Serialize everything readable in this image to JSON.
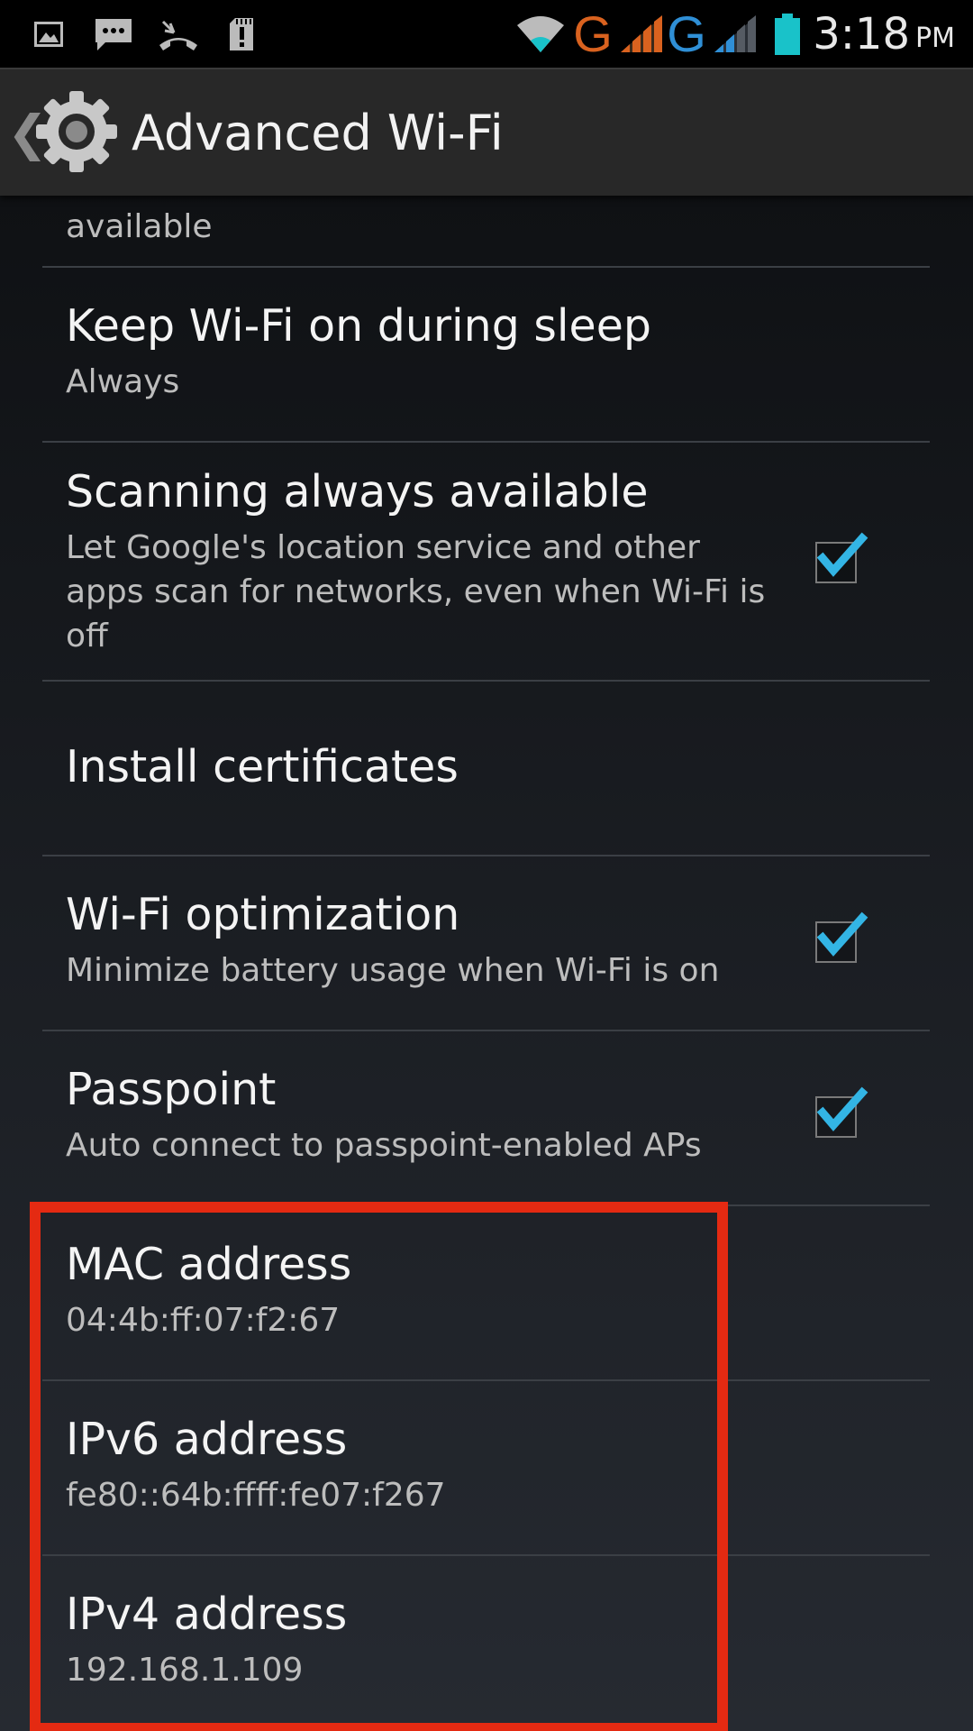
{
  "status_bar": {
    "time": "3:18",
    "ampm": "PM",
    "network_1": "G",
    "network_2": "G",
    "network_1_color": "#d9621f",
    "network_2_color": "#2f8fd6",
    "battery_color": "#19c2c9",
    "icons": [
      "gallery-icon",
      "message-icon",
      "missed-call-icon",
      "sd-card-alert-icon",
      "wifi-icon",
      "signal-icon",
      "battery-icon"
    ]
  },
  "action_bar": {
    "title": "Advanced Wi-Fi",
    "back_glyph": "❮",
    "icon": "settings-gear-icon"
  },
  "preferences": {
    "partial_summary": "available",
    "keep_wifi_on": {
      "title": "Keep Wi-Fi on during sleep",
      "summary": "Always"
    },
    "scanning": {
      "title": "Scanning always available",
      "summary": "Let Google's location service and other apps scan for networks, even when Wi-Fi is off",
      "checked": true
    },
    "install_certificates": {
      "title": "Install certificates"
    },
    "wifi_optimization": {
      "title": "Wi-Fi optimization",
      "summary": "Minimize battery usage when Wi-Fi is on",
      "checked": true
    },
    "passpoint": {
      "title": "Passpoint",
      "summary": "Auto connect to passpoint-enabled APs",
      "checked": true
    },
    "mac_address": {
      "title": "MAC address",
      "value": "04:4b:ff:07:f2:67"
    },
    "ipv6_address": {
      "title": "IPv6 address",
      "value": "fe80::64b:ffff:fe07:f267"
    },
    "ipv4_address": {
      "title": "IPv4 address",
      "value": "192.168.1.109"
    }
  },
  "colors": {
    "highlight": "#e42a12",
    "checkmark": "#33b5e5"
  }
}
